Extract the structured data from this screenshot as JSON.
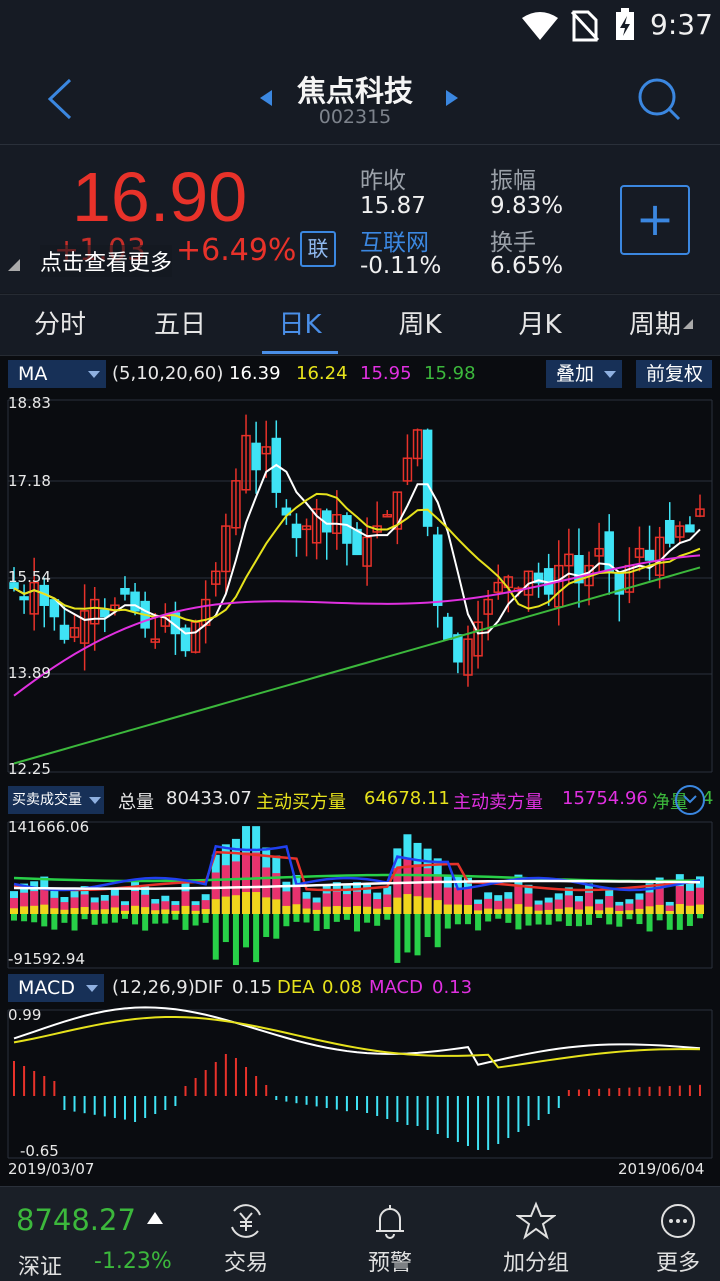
{
  "status_bar": {
    "time": "9:37"
  },
  "header": {
    "stock_name": "焦点科技",
    "stock_code": "002315"
  },
  "quote": {
    "price": "16.90",
    "change_hidden": "+1.03",
    "change_pct": "+6.49%",
    "tap_more": "点击查看更多",
    "lian_badge": "联",
    "prev_close_label": "昨收",
    "prev_close_value": "15.87",
    "sector_label": "互联网",
    "sector_value": "-0.11%",
    "amplitude_label": "振幅",
    "amplitude_value": "9.83%",
    "turnover_label": "换手",
    "turnover_value": "6.65%",
    "add_button": "+"
  },
  "tabs": [
    {
      "label": "分时"
    },
    {
      "label": "五日"
    },
    {
      "label": "日K"
    },
    {
      "label": "周K"
    },
    {
      "label": "月K"
    },
    {
      "label": "周期"
    }
  ],
  "main_chart": {
    "indicator": "MA",
    "params": "(5,10,20,60)",
    "ma5": "16.39",
    "ma10": "16.24",
    "ma20": "15.95",
    "ma60": "15.98",
    "overlay_label": "叠加",
    "adjust_label": "前复权",
    "y_ticks": [
      "18.83",
      "17.18",
      "15.54",
      "13.89",
      "12.25"
    ]
  },
  "volume_panel": {
    "indicator": "买卖成交量",
    "total_label": "总量",
    "total_value": "80433.07",
    "buy_label": "主动买方量",
    "buy_value": "64678.11",
    "sell_label": "主动卖方量",
    "sell_value": "15754.96",
    "net_label": "净量",
    "net_value": "4",
    "y_max": "141666.06",
    "y_min": "-91592.94"
  },
  "macd_panel": {
    "indicator": "MACD",
    "params": "(12,26,9)",
    "dif_label": "DIF",
    "dif_value": "0.15",
    "dea_label": "DEA",
    "dea_value": "0.08",
    "macd_label": "MACD",
    "macd_value": "0.13",
    "y_max": "0.99",
    "y_min": "-0.65",
    "date_start": "2019/03/07",
    "date_end": "2019/06/04"
  },
  "bottom_nav": {
    "index_value": "8748.27",
    "index_name": "深证",
    "index_change": "-1.23%",
    "items": [
      {
        "label": "交易",
        "icon": "yuan-exchange-icon"
      },
      {
        "label": "预警",
        "icon": "bell-icon"
      },
      {
        "label": "加分组",
        "icon": "star-icon"
      },
      {
        "label": "更多",
        "icon": "more-icon"
      }
    ]
  },
  "colors": {
    "up": "#e8322a",
    "down": "#3fe3f5",
    "accent": "#4a8fe8",
    "ma5": "#ffffff",
    "ma10": "#e6e21c",
    "ma20": "#e030e0",
    "ma60": "#3cb83c"
  }
}
